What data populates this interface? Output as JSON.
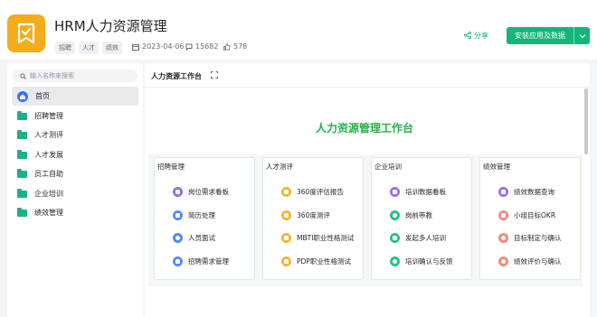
{
  "app": {
    "title": "HRM人力资源管理",
    "tags": [
      "招聘",
      "人才",
      "绩效"
    ],
    "date": "2023-04-06",
    "comments": "15682",
    "likes": "578",
    "share_label": "分享",
    "install_label": "安装应用及数据",
    "accent": "#14b579",
    "logo_color": "#f4ac1b"
  },
  "sidebar": {
    "search_placeholder": "输入名称来搜索",
    "items": [
      {
        "label": "首页",
        "icon": "home-icon"
      },
      {
        "label": "招聘管理",
        "icon": "folder-icon"
      },
      {
        "label": "人才测评",
        "icon": "folder-icon"
      },
      {
        "label": "人才发展",
        "icon": "folder-icon"
      },
      {
        "label": "员工自助",
        "icon": "folder-icon"
      },
      {
        "label": "企业培训",
        "icon": "folder-icon"
      },
      {
        "label": "绩效管理",
        "icon": "folder-icon"
      }
    ]
  },
  "main": {
    "title": "人力资源工作台",
    "banner_title": "人力资源管理工作台",
    "banner_color": "#26b14a",
    "cards": [
      {
        "title": "招聘管理",
        "items": [
          {
            "label": "岗位需求看板",
            "color": "#8b6cf2"
          },
          {
            "label": "简历处理",
            "color": "#4f8cf7"
          },
          {
            "label": "人员面试",
            "color": "#4f8cf7"
          },
          {
            "label": "招聘需求管理",
            "color": "#4f8cf7"
          }
        ]
      },
      {
        "title": "人才测评",
        "items": [
          {
            "label": "360度评估报告",
            "color": "#f7b32b"
          },
          {
            "label": "360度测评",
            "color": "#f7b32b"
          },
          {
            "label": "MBTI职业性格测试",
            "color": "#f7b32b"
          },
          {
            "label": "PDP职业性格测试",
            "color": "#f7b32b"
          }
        ]
      },
      {
        "title": "企业培训",
        "items": [
          {
            "label": "培训数据看板",
            "color": "#9b6cf0"
          },
          {
            "label": "岗前带教",
            "color": "#27c08a"
          },
          {
            "label": "发起多人培训",
            "color": "#27c08a"
          },
          {
            "label": "培训确认与反馈",
            "color": "#27c08a"
          }
        ]
      },
      {
        "title": "绩效管理",
        "items": [
          {
            "label": "绩效数据查询",
            "color": "#9b6cf0"
          },
          {
            "label": "小组目标OKR",
            "color": "#f08a7e"
          },
          {
            "label": "目标制定与确认",
            "color": "#f08a7e"
          },
          {
            "label": "绩效评价与确认",
            "color": "#f08a7e"
          }
        ]
      }
    ]
  }
}
